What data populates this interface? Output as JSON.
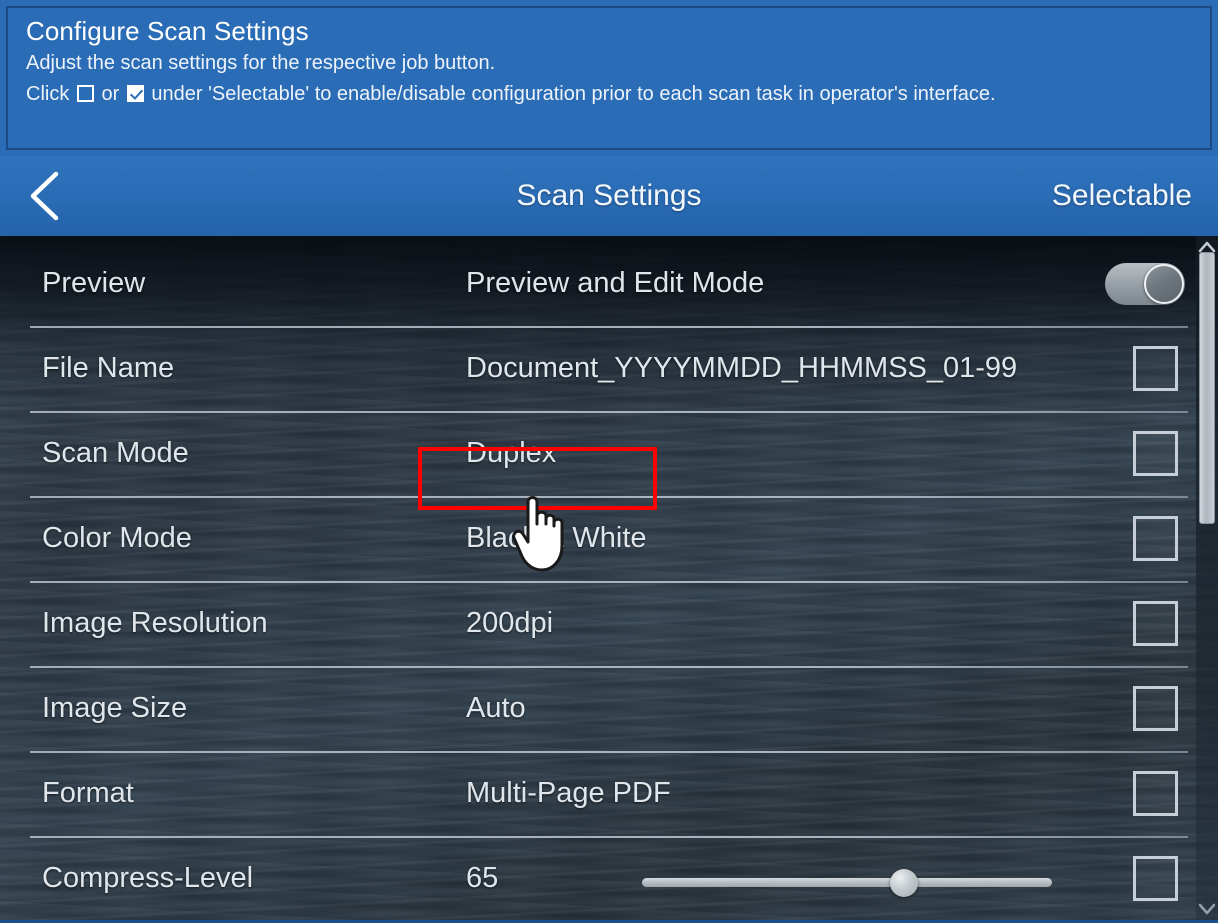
{
  "instructions": {
    "title": "Configure Scan Settings",
    "line1": "Adjust the scan settings for the respective job button.",
    "line2_a": "Click",
    "line2_b": "or",
    "line2_c": "under 'Selectable' to enable/disable configuration prior to each scan task in operator's interface."
  },
  "title_bar": {
    "back_icon": "chevron-left-icon",
    "title": "Scan Settings",
    "right_label": "Selectable"
  },
  "settings_rows": [
    {
      "label": "Preview",
      "value": "Preview and Edit Mode",
      "control": "toggle",
      "toggle_on": false
    },
    {
      "label": "File Name",
      "value": "Document_YYYYMMDD_HHMMSS_01-99",
      "control": "checkbox",
      "checked": false
    },
    {
      "label": "Scan Mode",
      "value": "Duplex",
      "control": "checkbox",
      "checked": false,
      "highlighted": true
    },
    {
      "label": "Color Mode",
      "value": "Black & White",
      "control": "checkbox",
      "checked": false
    },
    {
      "label": "Image Resolution",
      "value": "200dpi",
      "control": "checkbox",
      "checked": false
    },
    {
      "label": "Image Size",
      "value": "Auto",
      "control": "checkbox",
      "checked": false
    },
    {
      "label": "Format",
      "value": "Multi-Page PDF",
      "control": "checkbox",
      "checked": false
    },
    {
      "label": "Compress-Level",
      "value": "65",
      "control": "slider",
      "checked": false,
      "slider_percent": 64
    }
  ],
  "colors": {
    "panel_blue": "#2a6cb5",
    "panel_border": "#1b4b86",
    "list_background": "#2b3a47",
    "text": "#dfe6ec",
    "highlight": "#ff0000",
    "control_gray": "#c6cfd8"
  },
  "scrollbar": {
    "up_icon": "scroll-up-arrow-icon",
    "down_icon": "scroll-down-arrow-icon",
    "thumb_label": "scroll-thumb"
  }
}
